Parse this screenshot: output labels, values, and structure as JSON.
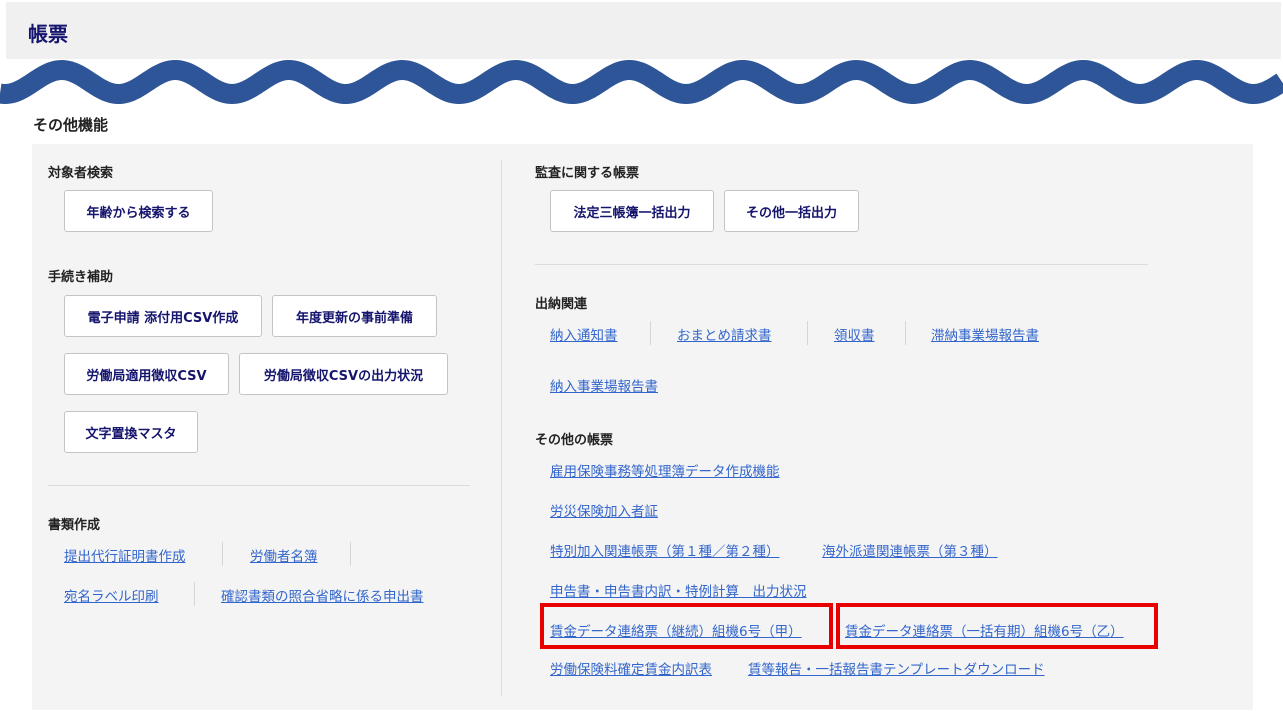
{
  "header": {
    "title": "帳票"
  },
  "section": {
    "title": "その他機能"
  },
  "left": {
    "target_search": {
      "label": "対象者検索",
      "buttons": [
        "年齢から検索する"
      ]
    },
    "procedure_support": {
      "label": "手続き補助",
      "buttons": [
        "電子申請 添付用CSV作成",
        "年度更新の事前準備",
        "労働局適用徴収CSV",
        "労働局徴収CSVの出力状況",
        "文字置換マスタ"
      ]
    },
    "document_creation": {
      "label": "書類作成",
      "links": [
        "提出代行証明書作成",
        "労働者名簿",
        "宛名ラベル印刷",
        "確認書類の照合省略に係る申出書"
      ]
    }
  },
  "right": {
    "audit": {
      "label": "監査に関する帳票",
      "buttons": [
        "法定三帳簿一括出力",
        "その他一括出力"
      ]
    },
    "payment": {
      "label": "出納関連",
      "links": [
        "納入通知書",
        "おまとめ請求書",
        "領収書",
        "滞納事業場報告書",
        "納入事業場報告書"
      ]
    },
    "other": {
      "label": "その他の帳票",
      "links": [
        "雇用保険事務等処理簿データ作成機能",
        "労災保険加入者証",
        "特別加入関連帳票（第１種／第２種）",
        "海外派遣関連帳票（第３種）",
        "申告書・申告書内訳・特例計算　出力状況",
        "賃金データ連絡票（継続）組機6号（甲）",
        "賃金データ連絡票（一括有期）組機6号（乙）",
        "労働保険料確定賃金内訳表",
        "賃等報告・一括報告書テンプレートダウンロード"
      ]
    }
  },
  "colors": {
    "accent_navy": "#15156e",
    "link_blue": "#3366cc",
    "wave_blue": "#2e5597",
    "highlight_red": "#e80000"
  }
}
